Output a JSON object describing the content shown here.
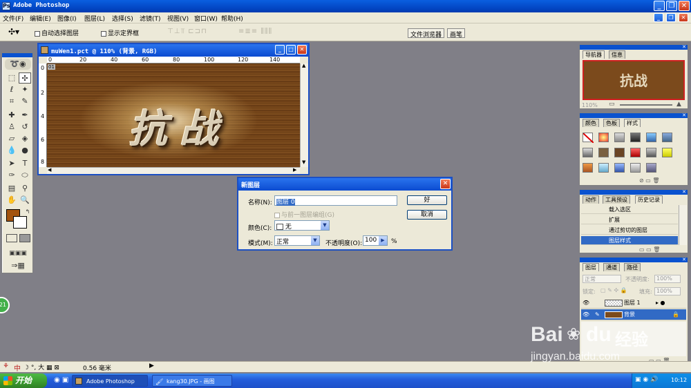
{
  "window": {
    "title": "Adobe Photoshop"
  },
  "menu": [
    "文件(F)",
    "编辑(E)",
    "图像(I)",
    "图层(L)",
    "选择(S)",
    "滤镜(T)",
    "视图(V)",
    "窗口(W)",
    "帮助(H)"
  ],
  "options": {
    "auto_select": "自动选择图层",
    "show_bounds": "显示定界框",
    "tab_browser": "文件浏览器",
    "tab_brushes": "画笔"
  },
  "document": {
    "title": "muWen1.pct @ 110% (背景, RGB)",
    "ruler_h": [
      "0",
      "20",
      "40",
      "60",
      "80",
      "100",
      "120",
      "140"
    ],
    "ruler_v": [
      "0",
      "2",
      "4",
      "6",
      "8"
    ],
    "artwork_text": "抗战",
    "slice_badge": "01"
  },
  "dialog": {
    "title": "新图层",
    "name_label": "名称(N):",
    "name_value": "图层 0",
    "group_label": "与前一图层编组(G)",
    "color_label": "颜色(C):",
    "color_value": "无",
    "mode_label": "模式(M):",
    "mode_value": "正常",
    "opacity_label": "不透明度(O):",
    "opacity_value": "100",
    "opacity_unit": "%",
    "ok": "好",
    "cancel": "取消"
  },
  "navigator": {
    "tabs": [
      "导航器",
      "信息"
    ],
    "zoom": "110%",
    "thumb_text": "抗战"
  },
  "styles_panel": {
    "tabs": [
      "颜色",
      "色板",
      "样式"
    ]
  },
  "history_panel": {
    "tabs": [
      "动作",
      "工具预设",
      "历史记录"
    ],
    "items": [
      "载入选区",
      "扩展",
      "通过剪切的图层",
      "图层样式"
    ]
  },
  "layers_panel": {
    "tabs": [
      "图层",
      "通道",
      "路径"
    ],
    "blend_mode": "正常",
    "opacity_label": "不透明度:",
    "opacity_value": "100%",
    "lock_label": "锁定:",
    "fill_label": "填充:",
    "fill_value": "100%",
    "layers": [
      "图层 1",
      "背景"
    ]
  },
  "status": {
    "doc_info": "0.56 毫米",
    "ime": "中"
  },
  "taskbar": {
    "start": "开始",
    "tasks": [
      "Adobe Photoshop",
      "kang30.JPG - 画图"
    ],
    "clock": "10:12"
  },
  "watermark": {
    "brand": "Bai",
    "brand2": "du",
    "product": "经验",
    "url": "jingyan.baidu.com"
  }
}
